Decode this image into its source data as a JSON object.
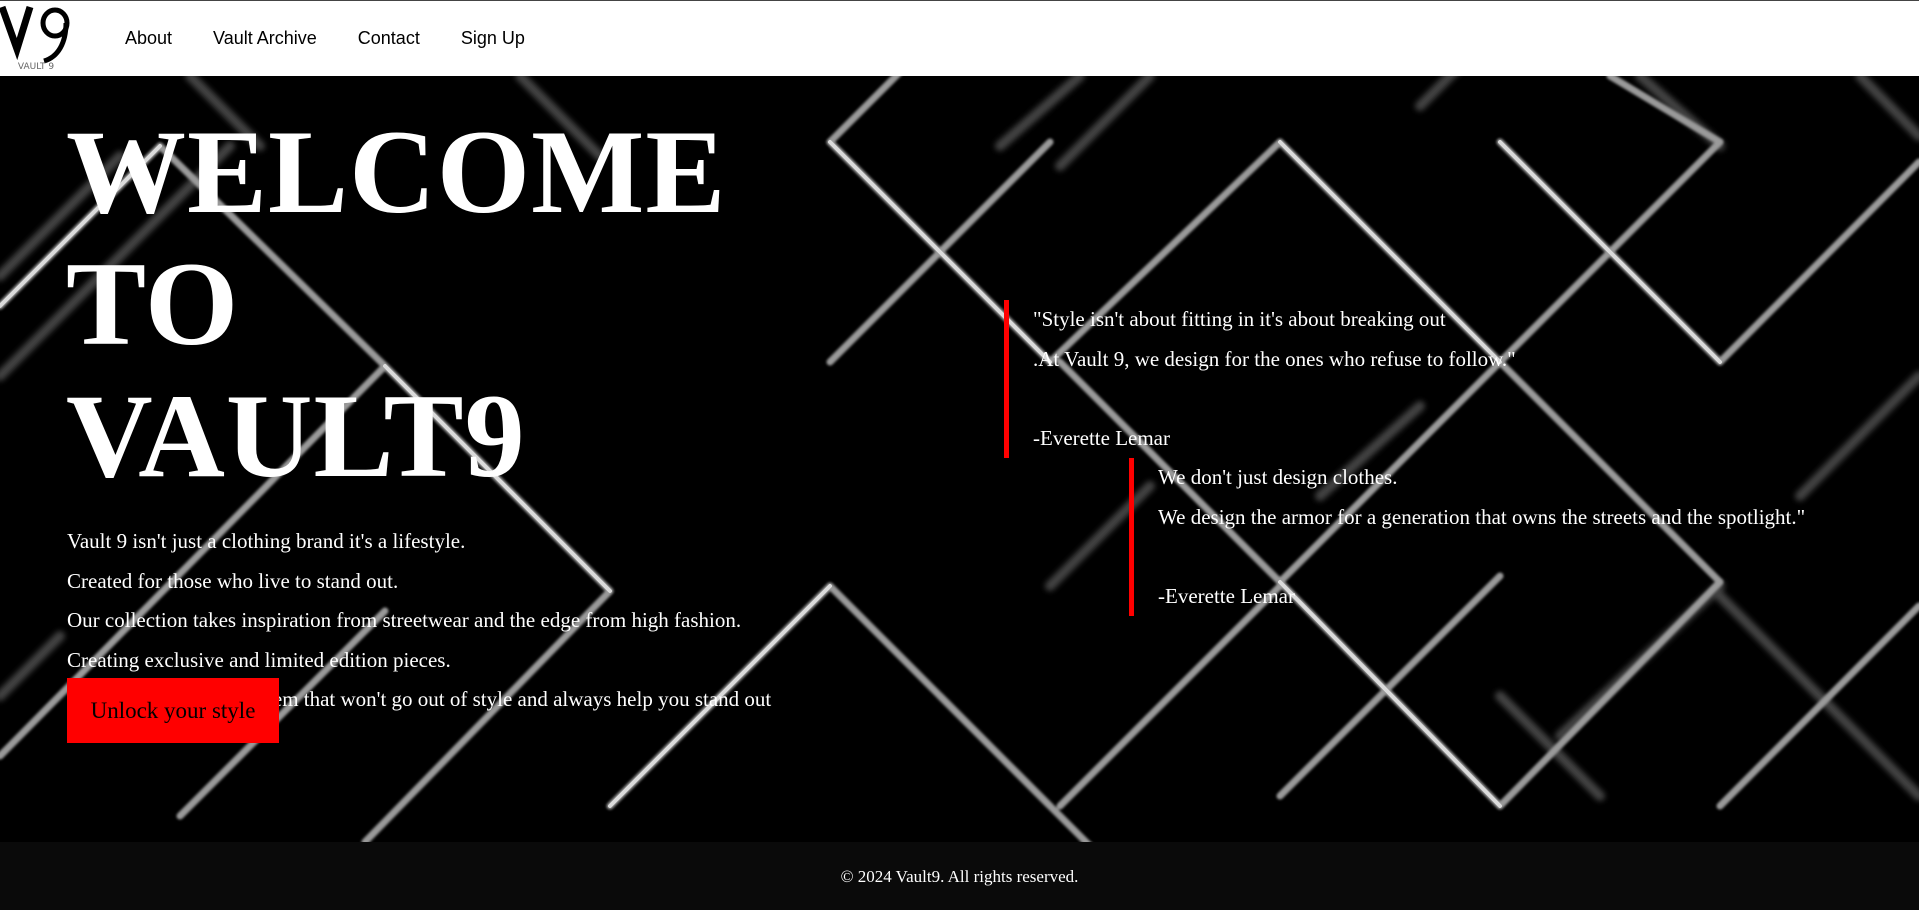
{
  "brand": {
    "logo_mark": "V9",
    "logo_text": "VAULT 9"
  },
  "nav": {
    "items": [
      {
        "label": "About"
      },
      {
        "label": "Vault Archive"
      },
      {
        "label": "Contact"
      },
      {
        "label": "Sign Up"
      }
    ]
  },
  "hero": {
    "title_lines": [
      "WELCOME",
      "TO",
      "VAULT9"
    ],
    "description": [
      "Vault 9 isn't just a clothing brand it's a lifestyle.",
      "Created for those who live to stand out.",
      "Our collection takes inspiration from streetwear and the edge from high fashion.",
      "Creating exclusive and limited edition pieces.",
      "Every drop is a hidden gem that won't go out of style and always help you stand out"
    ],
    "cta_label": "Unlock your style"
  },
  "quotes": [
    {
      "lines": [
        "\"Style isn't about fitting in it's about breaking out",
        ".At Vault 9, we design for the ones who refuse to follow.\""
      ],
      "author": "-Everette Lemar"
    },
    {
      "lines": [
        "We don't just design clothes.",
        "We design the armor for a generation that owns the streets and the spotlight.\""
      ],
      "author": "-Everette Lemar"
    }
  ],
  "footer": {
    "copyright": "© 2024 Vault9. All rights reserved."
  },
  "colors": {
    "accent": "#ff0000",
    "background": "#000000",
    "navbar": "#ffffff",
    "footer": "#0a0a0a",
    "text": "#ffffff"
  }
}
